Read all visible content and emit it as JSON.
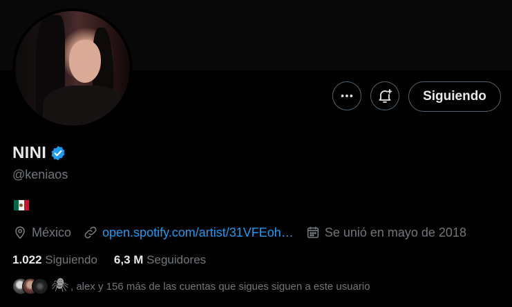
{
  "profile": {
    "display_name": "NINI",
    "handle": "@keniaos",
    "location": "México",
    "link": "open.spotify.com/artist/31VFEoh…",
    "joined": "Se unió en mayo de 2018"
  },
  "actions": {
    "follow_label": "Siguiendo"
  },
  "stats": {
    "following_count": "1.022",
    "following_label": "Siguiendo",
    "followers_count": "6,3 M",
    "followers_label": "Seguidores"
  },
  "mutuals": {
    "text": ", alex y 156 más de las cuentas que sigues siguen a este usuario"
  },
  "colors": {
    "background": "#000000",
    "text": "#e7e9ea",
    "muted": "#71767b",
    "accent": "#1d9bf0",
    "border": "#536471"
  },
  "icons": {
    "more": "more-icon",
    "notification": "bell-plus-icon",
    "verified": "verified-badge-icon",
    "location": "location-pin-icon",
    "link": "link-icon",
    "calendar": "calendar-icon",
    "flag": "mexico-flag-emoji"
  }
}
